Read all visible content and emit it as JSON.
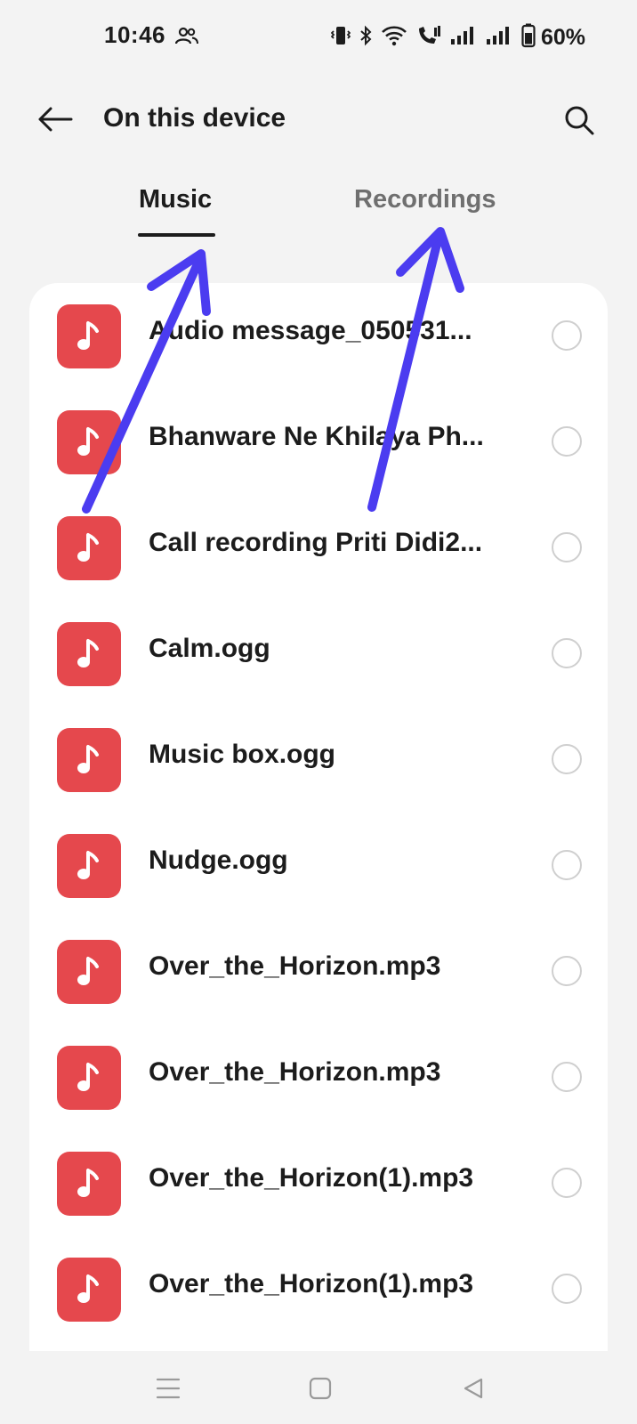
{
  "status_bar": {
    "time": "10:46",
    "battery_percent": "60%",
    "icons": [
      "people-icon",
      "vibrate-icon",
      "bluetooth-icon",
      "wifi-icon",
      "wifi-calling-icon",
      "signal-icon",
      "signal-icon",
      "battery-icon"
    ]
  },
  "app_bar": {
    "title": "On this device",
    "back_icon": "arrow-left-icon",
    "search_icon": "search-icon"
  },
  "tabs": [
    {
      "label": "Music",
      "selected": true
    },
    {
      "label": "Recordings",
      "selected": false
    }
  ],
  "files": [
    {
      "name": "Audio message_050531...",
      "icon": "music-note-icon",
      "selected": false
    },
    {
      "name": "Bhanware Ne Khilaya Ph...",
      "icon": "music-note-icon",
      "selected": false
    },
    {
      "name": "Call recording Priti Didi2...",
      "icon": "music-note-icon",
      "selected": false
    },
    {
      "name": "Calm.ogg",
      "icon": "music-note-icon",
      "selected": false
    },
    {
      "name": "Music box.ogg",
      "icon": "music-note-icon",
      "selected": false
    },
    {
      "name": "Nudge.ogg",
      "icon": "music-note-icon",
      "selected": false
    },
    {
      "name": "Over_the_Horizon.mp3",
      "icon": "music-note-icon",
      "selected": false
    },
    {
      "name": "Over_the_Horizon.mp3",
      "icon": "music-note-icon",
      "selected": false
    },
    {
      "name": "Over_the_Horizon(1).mp3",
      "icon": "music-note-icon",
      "selected": false
    },
    {
      "name": "Over_the_Horizon(1).mp3",
      "icon": "music-note-icon",
      "selected": false
    }
  ],
  "nav_bar": {
    "icons": [
      "menu-icon",
      "home-icon",
      "back-triangle-icon"
    ]
  },
  "colors": {
    "file_icon_bg": "#e5484d",
    "annotation_arrow": "#4b3cf0",
    "background": "#f3f3f3"
  }
}
